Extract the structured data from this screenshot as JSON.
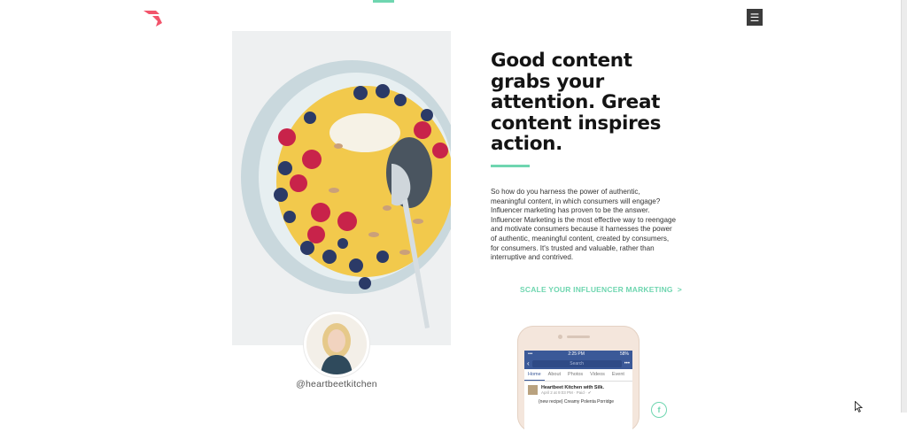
{
  "nav": {
    "menu_icon": "hamburger-icon",
    "logo": "brand-logo"
  },
  "colors": {
    "accent": "#6fd6b0",
    "logo": "#f2546b",
    "menu_bg": "#3b3b3b",
    "facebook": "#3b5998"
  },
  "hero": {
    "headline": "Good content grabs your attention. Great content inspires action.",
    "body": "So how do you harness the power of authentic, meaningful content, in which consumers will engage? Influencer marketing has proven to be the answer. Influencer Marketing is the most effective way to reengage and motivate consumers because it harnesses the power of authentic, meaningful content, created by consumers, for consumers. It's trusted and valuable, rather than interruptive and contrived.",
    "cta_label": "SCALE YOUR INFLUENCER MARKETING",
    "cta_chevron": ">"
  },
  "influencer": {
    "handle": "@heartbeetkitchen"
  },
  "phone": {
    "time": "2:25 PM",
    "battery": "58%",
    "search_placeholder": "Search",
    "tabs": [
      "Home",
      "About",
      "Photos",
      "Videos",
      "Event"
    ],
    "post_author": "Heartbeet Kitchen",
    "post_with": "with Silk.",
    "post_meta": "April 2 at 9:03 PM · Paid · ✔",
    "post_text": "{new recipe} Creamy Polenta Porridge"
  },
  "social": {
    "facebook_label": "f"
  }
}
